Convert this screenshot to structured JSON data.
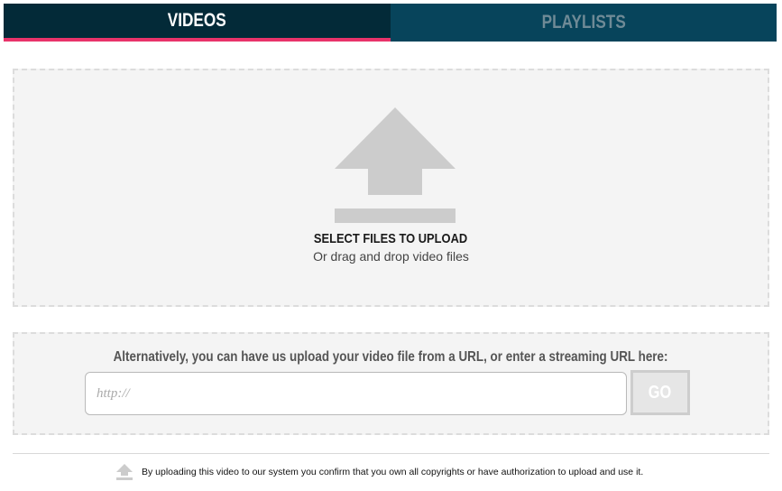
{
  "tabs": [
    {
      "label": "VIDEOS",
      "active": true
    },
    {
      "label": "PLAYLISTS",
      "active": false
    }
  ],
  "colors": {
    "active_tab_bg": "#032a38",
    "inactive_tab_bg": "#07445b",
    "active_underline": "#e8336a",
    "dropzone_bg": "#f4f4f4",
    "icon_gray": "#cccccc"
  },
  "dropzone": {
    "icon": "upload-arrow-icon",
    "title": "SELECT FILES TO UPLOAD",
    "subtitle": "Or drag and drop video files"
  },
  "url_upload": {
    "label": "Alternatively, you can have us upload your video file from a URL, or enter a streaming URL here:",
    "placeholder": "http://",
    "value": "",
    "go_label": "GO"
  },
  "footer": {
    "icon": "upload-arrow-icon",
    "text": "By uploading this video to our system you confirm that you own all copyrights or have authorization to upload and use it."
  }
}
